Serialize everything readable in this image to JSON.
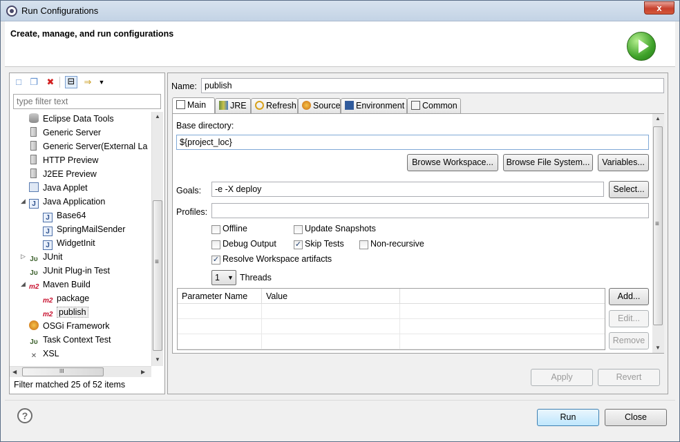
{
  "window": {
    "title": "Run Configurations",
    "close_glyph": "x"
  },
  "header": {
    "title": "Create, manage, and run configurations"
  },
  "left": {
    "filter_placeholder": "type filter text",
    "tree": [
      {
        "label": "Eclipse Data Tools",
        "icon": "database-icon"
      },
      {
        "label": "Generic Server",
        "icon": "server-icon"
      },
      {
        "label": "Generic Server(External La",
        "icon": "server-icon"
      },
      {
        "label": "HTTP Preview",
        "icon": "server-icon"
      },
      {
        "label": "J2EE Preview",
        "icon": "server-icon"
      },
      {
        "label": "Java Applet",
        "icon": "applet-icon"
      },
      {
        "label": "Java Application",
        "icon": "java-app-icon"
      },
      {
        "label": "Base64",
        "icon": "java-app-icon"
      },
      {
        "label": "SpringMailSender",
        "icon": "java-app-icon"
      },
      {
        "label": "WidgetInit",
        "icon": "java-app-icon"
      },
      {
        "label": "JUnit",
        "icon": "junit-icon"
      },
      {
        "label": "JUnit Plug-in Test",
        "icon": "junit-plugin-icon"
      },
      {
        "label": "Maven Build",
        "icon": "maven-icon"
      },
      {
        "label": "package",
        "icon": "maven-icon"
      },
      {
        "label": "publish",
        "icon": "maven-icon"
      },
      {
        "label": "OSGi Framework",
        "icon": "osgi-icon"
      },
      {
        "label": "Task Context Test",
        "icon": "junit-icon"
      },
      {
        "label": "XSL",
        "icon": "xsl-icon"
      }
    ],
    "icon_text": {
      "j": "J",
      "ju": "Jᴜ",
      "m2": "m2",
      "xsl": "✕"
    },
    "twisty_collapsed": "▷",
    "twisty_expanded": "◢",
    "hscroll_grip": "III",
    "vscroll_grip": "≡",
    "arrow_up": "▲",
    "arrow_down": "▼",
    "arrow_left": "◀",
    "arrow_right": "▶",
    "status": "Filter matched 25 of 52 items"
  },
  "right": {
    "name_label": "Name:",
    "name_value": "publish",
    "tabs": [
      "Main",
      "JRE",
      "Refresh",
      "Source",
      "Environment",
      "Common"
    ],
    "base_dir_label": "Base directory:",
    "base_dir_value": "${project_loc}",
    "browse_workspace": "Browse Workspace...",
    "browse_fs": "Browse File System...",
    "variables": "Variables...",
    "goals_label": "Goals:",
    "goals_value": "-e  -X deploy",
    "select": "Select...",
    "profiles_label": "Profiles:",
    "profiles_value": "",
    "options": {
      "offline": "Offline",
      "update_snapshots": "Update Snapshots",
      "debug_output": "Debug Output",
      "skip_tests": "Skip Tests",
      "non_recursive": "Non-recursive",
      "resolve_ws": "Resolve Workspace artifacts"
    },
    "check_mark": "✓",
    "threads_value": "1",
    "threads_label": "Threads",
    "table_headers": [
      "Parameter Name",
      "Value"
    ],
    "add": "Add...",
    "edit": "Edit...",
    "remove": "Remove",
    "apply": "Apply",
    "revert": "Revert"
  },
  "footer": {
    "run": "Run",
    "close": "Close",
    "help_glyph": "?"
  }
}
